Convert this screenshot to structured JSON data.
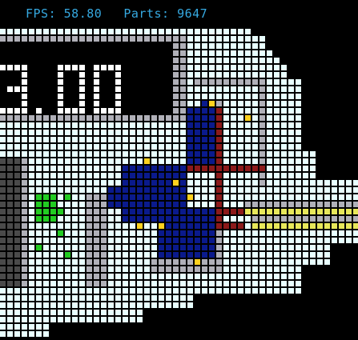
{
  "hud": {
    "fps_label": "FPS:",
    "fps_value": "58.80",
    "parts_label": "Parts:",
    "parts_value": "9647"
  },
  "display": {
    "value": "3.00"
  },
  "colors": {
    "background": "#000000",
    "hud_text": "#36a9e1",
    "glass": "#e8ffff",
    "glass_grid": "#000000",
    "metal": "#b0b0b8",
    "dark_metal": "#4a4a4a",
    "display_bg": "#000000",
    "display_digit": "#ffffff",
    "water_blue": "#0a1a8c",
    "insulator_red": "#8c1a1a",
    "spark_yellow": "#ffd21e",
    "plant_green": "#22cc22",
    "beam_yellow": "#e8e85a"
  }
}
